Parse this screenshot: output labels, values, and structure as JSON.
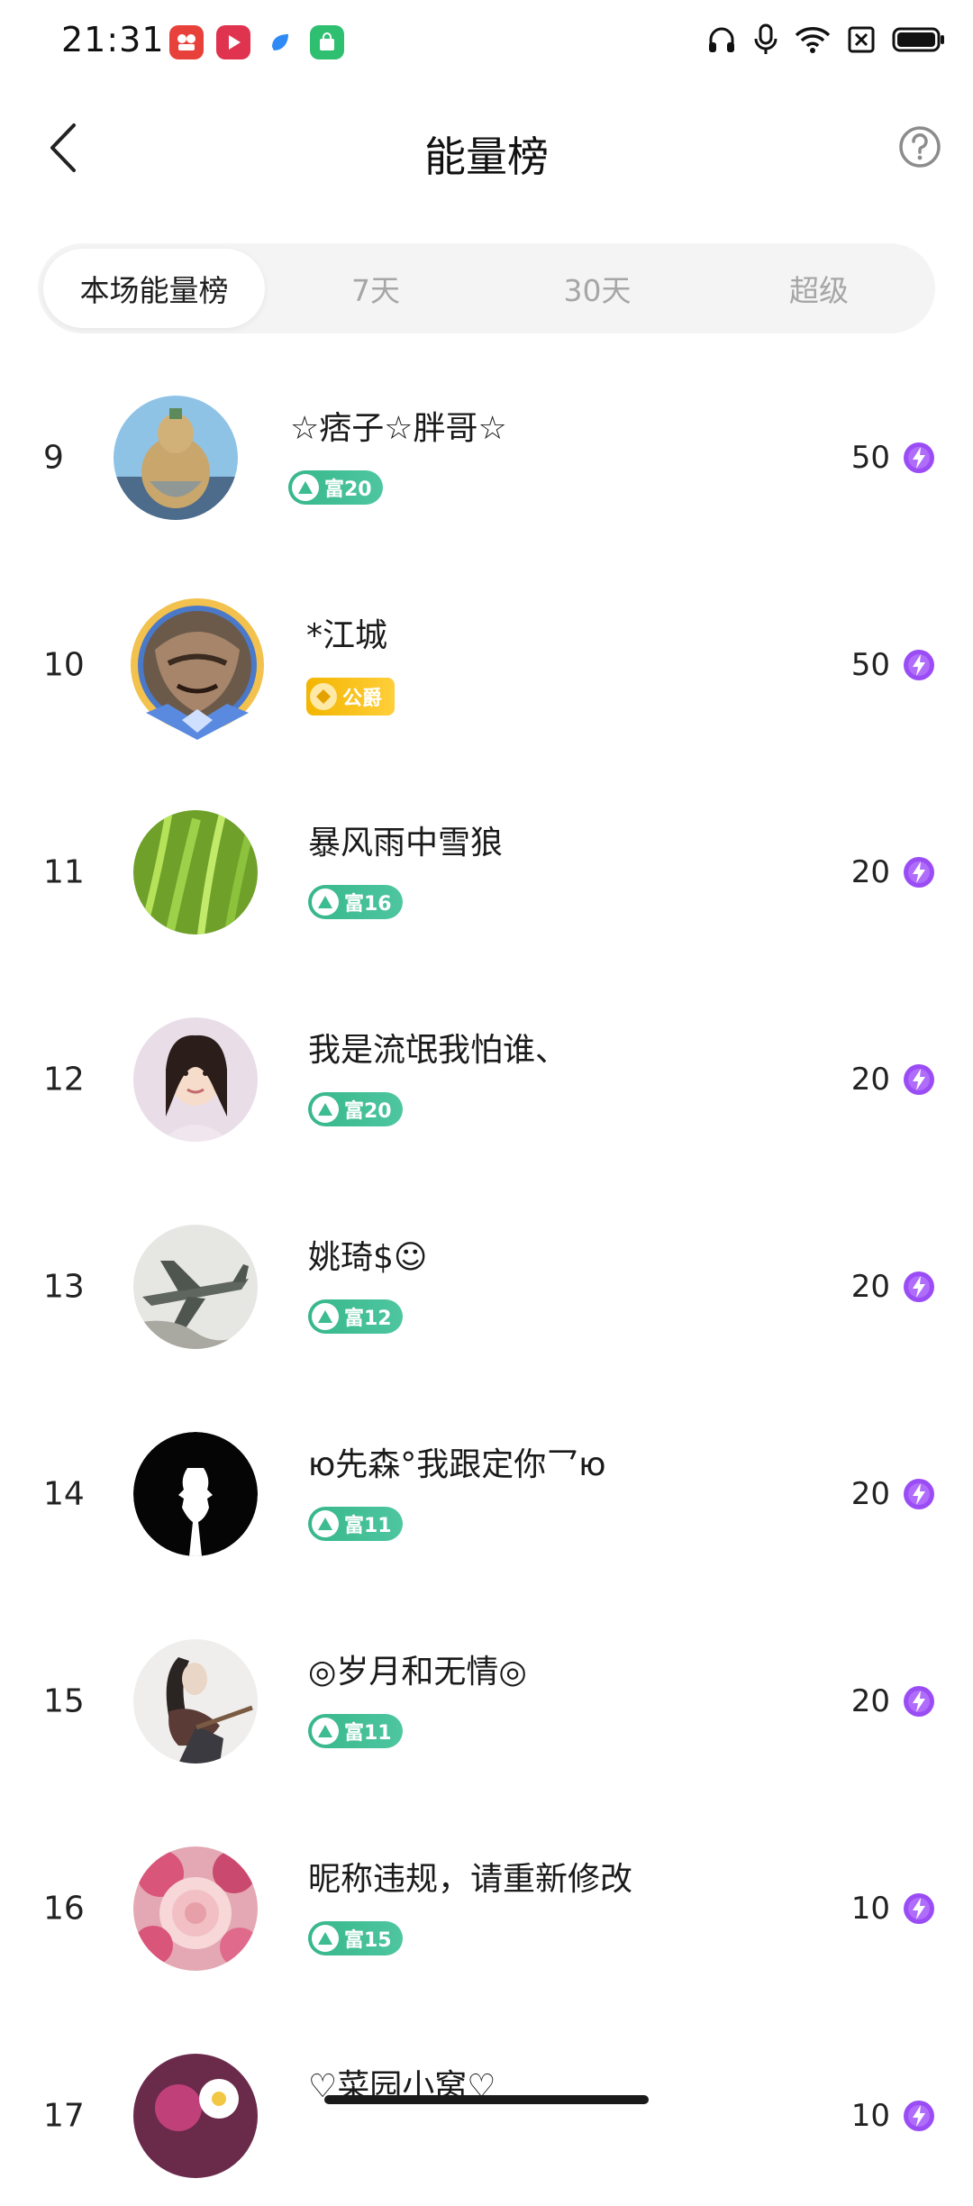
{
  "status_bar": {
    "time": "21:31",
    "apps": [
      {
        "icon": "video-app-icon",
        "color": "#e8413c"
      },
      {
        "icon": "play-app-icon",
        "color": "#e0334f"
      },
      {
        "icon": "blue-app-icon",
        "color": "#2f8af5"
      },
      {
        "icon": "store-app-icon",
        "color": "#2fbf71"
      }
    ],
    "indicators": [
      "headphones-icon",
      "microphone-icon",
      "wifi-icon",
      "sim-off-icon",
      "battery-icon"
    ]
  },
  "header": {
    "title": "能量榜",
    "back_icon": "chevron-left-icon",
    "help_icon": "question-circle-icon"
  },
  "tabs": [
    {
      "label": "本场能量榜",
      "active": true
    },
    {
      "label": "7天",
      "active": false
    },
    {
      "label": "30天",
      "active": false
    },
    {
      "label": "超级",
      "active": false
    }
  ],
  "ranking": [
    {
      "rank": "9",
      "name": "☆痞子☆胖哥☆",
      "badge": "富20",
      "badge_type": "green",
      "score": "50",
      "avatar": "gourd-statue"
    },
    {
      "rank": "10",
      "name": "*江城",
      "badge": "公爵",
      "badge_type": "gold",
      "score": "50",
      "avatar": "warrior-portrait-framed"
    },
    {
      "rank": "11",
      "name": "暴风雨中雪狼",
      "badge": "富16",
      "badge_type": "green",
      "score": "20",
      "avatar": "green-grass"
    },
    {
      "rank": "12",
      "name": "我是流氓我怕谁、",
      "badge": "富20",
      "badge_type": "green",
      "score": "20",
      "avatar": "woman-portrait"
    },
    {
      "rank": "13",
      "name": "姚琦$☺",
      "badge": "富12",
      "badge_type": "green",
      "score": "20",
      "avatar": "fighter-jet"
    },
    {
      "rank": "14",
      "name": "ю先森°我跟定你乛ю",
      "badge": "富11",
      "badge_type": "green",
      "score": "20",
      "avatar": "couple-silhouette"
    },
    {
      "rank": "15",
      "name": "◎岁月和无情◎",
      "badge": "富11",
      "badge_type": "green",
      "score": "20",
      "avatar": "girl-with-guitar"
    },
    {
      "rank": "16",
      "name": "昵称违规，请重新修改",
      "badge": "富15",
      "badge_type": "green",
      "score": "10",
      "avatar": "pink-peony"
    },
    {
      "rank": "17",
      "name": "♡菜园小窝♡",
      "badge": "",
      "badge_type": "green",
      "score": "10",
      "avatar": "flowers"
    }
  ],
  "colors": {
    "badge_green": "#3dbb91",
    "badge_gold": "#f5b800",
    "energy_purple": "#8a3df0"
  }
}
